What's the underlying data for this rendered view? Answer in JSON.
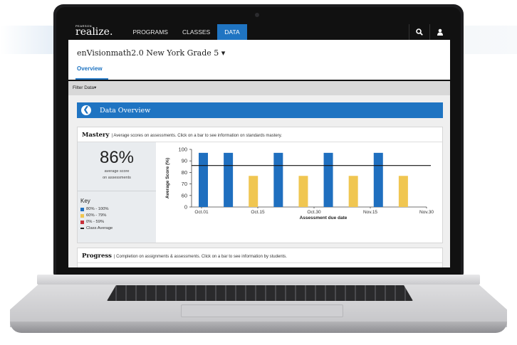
{
  "nav": {
    "logo_super": "PEARSON",
    "logo": "realize.",
    "items": [
      {
        "label": "PROGRAMS"
      },
      {
        "label": "CLASSES"
      },
      {
        "label": "DATA",
        "active": true
      }
    ],
    "search_icon": "search-icon",
    "user_icon": "user-icon"
  },
  "course": {
    "title": "enVisionmath2.0 New York Grade 5 ▾"
  },
  "tabs": {
    "overview": "Overview"
  },
  "filter": {
    "label": "Filter Data▾"
  },
  "data_overview": {
    "title": "Data Overview",
    "back_icon": "back-arrow-icon"
  },
  "mastery": {
    "heading": "Mastery",
    "description": "| Average scores on assessments. Click on a bar to see information on standards mastery.",
    "average_value": "86%",
    "average_label_1": "average score",
    "average_label_2": "on assessments",
    "key": {
      "title": "Key",
      "items": [
        {
          "label": "80% - 100%",
          "color": "#1f6fbf"
        },
        {
          "label": "60% - 79%",
          "color": "#f0c651"
        },
        {
          "label": "0% - 59%",
          "color": "#c8303a"
        },
        {
          "label": "Class Average",
          "color": "#222222"
        }
      ]
    }
  },
  "chart_data": {
    "type": "bar",
    "title": "",
    "xlabel": "Assessment due date",
    "ylabel": "Average Score (%)",
    "ylim": [
      0,
      100
    ],
    "yticks": [
      0,
      60,
      70,
      80,
      90,
      100
    ],
    "x_tick_labels": [
      "Oct.01",
      "Oct.15",
      "Oct.30",
      "Nov.15",
      "Nov.30"
    ],
    "class_average": 86,
    "bars": [
      {
        "value": 97,
        "color": "#1f6fbf"
      },
      {
        "value": 97,
        "color": "#1f6fbf"
      },
      {
        "value": 77,
        "color": "#f0c651"
      },
      {
        "value": 97,
        "color": "#1f6fbf"
      },
      {
        "value": 77,
        "color": "#f0c651"
      },
      {
        "value": 97,
        "color": "#1f6fbf"
      },
      {
        "value": 77,
        "color": "#f0c651"
      },
      {
        "value": 97,
        "color": "#1f6fbf"
      },
      {
        "value": 77,
        "color": "#f0c651"
      }
    ],
    "grid": false
  },
  "progress": {
    "heading": "Progress",
    "description": "| Completion on assignments & assessments. Click on a bar to see information by students."
  }
}
